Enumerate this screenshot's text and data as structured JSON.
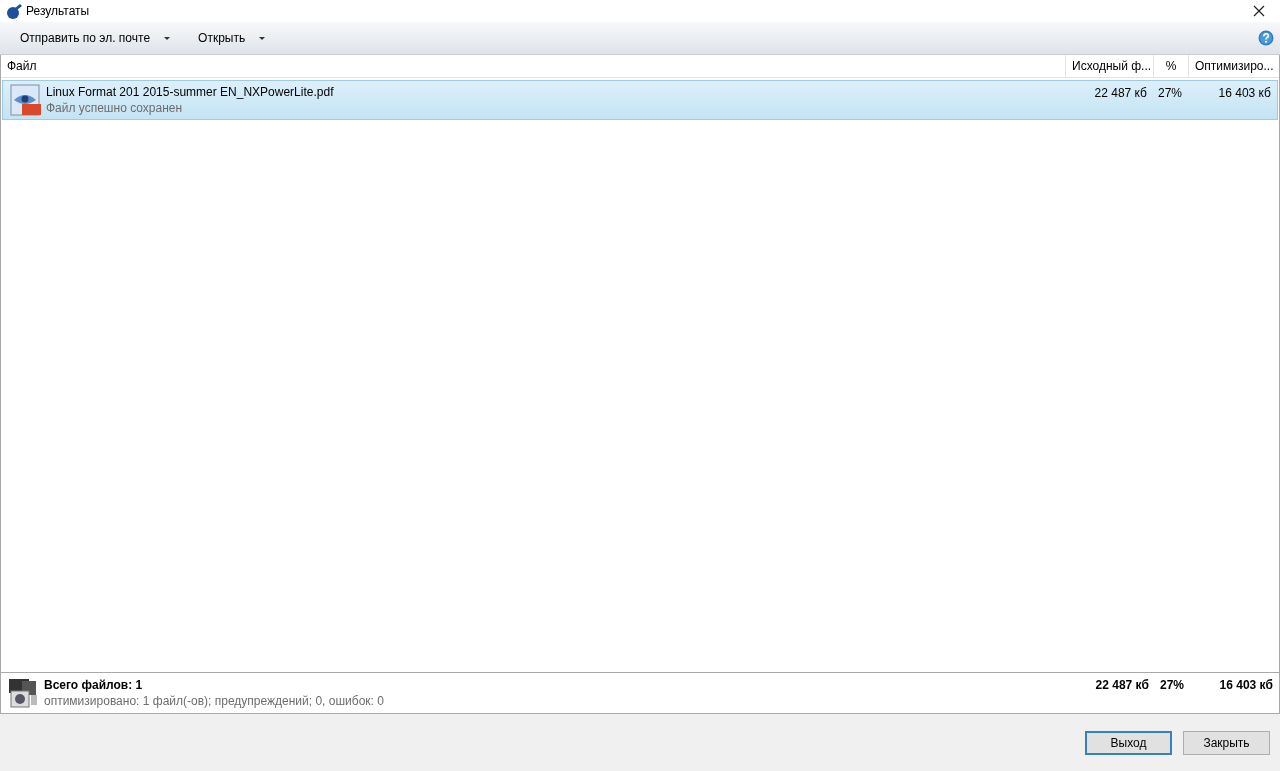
{
  "window": {
    "title": "Результаты"
  },
  "toolbar": [
    {
      "label": "Отправить по эл. почте",
      "dropdown": true
    },
    {
      "label": "Открыть",
      "dropdown": true
    }
  ],
  "table": {
    "columns": [
      "Файл",
      "Исходный ф...",
      "%",
      "Оптимизиро..."
    ],
    "rows": [
      {
        "name": "Linux Format 201 2015-summer EN_NXPowerLite.pdf",
        "status": "Файл успешно сохранен",
        "original": "22 487 кб",
        "percent": "27%",
        "optimized": "16 403 кб",
        "selected": true
      }
    ]
  },
  "summary": {
    "title": "Всего файлов: 1",
    "details": "оптимизировано: 1 файл(-ов); предупреждений; 0, ошибок: 0",
    "original": "22 487 кб",
    "percent": "27%",
    "optimized": "16 403 кб"
  },
  "buttons": [
    {
      "label": "Выход",
      "default": true
    },
    {
      "label": "Закрыть",
      "default": false
    }
  ]
}
